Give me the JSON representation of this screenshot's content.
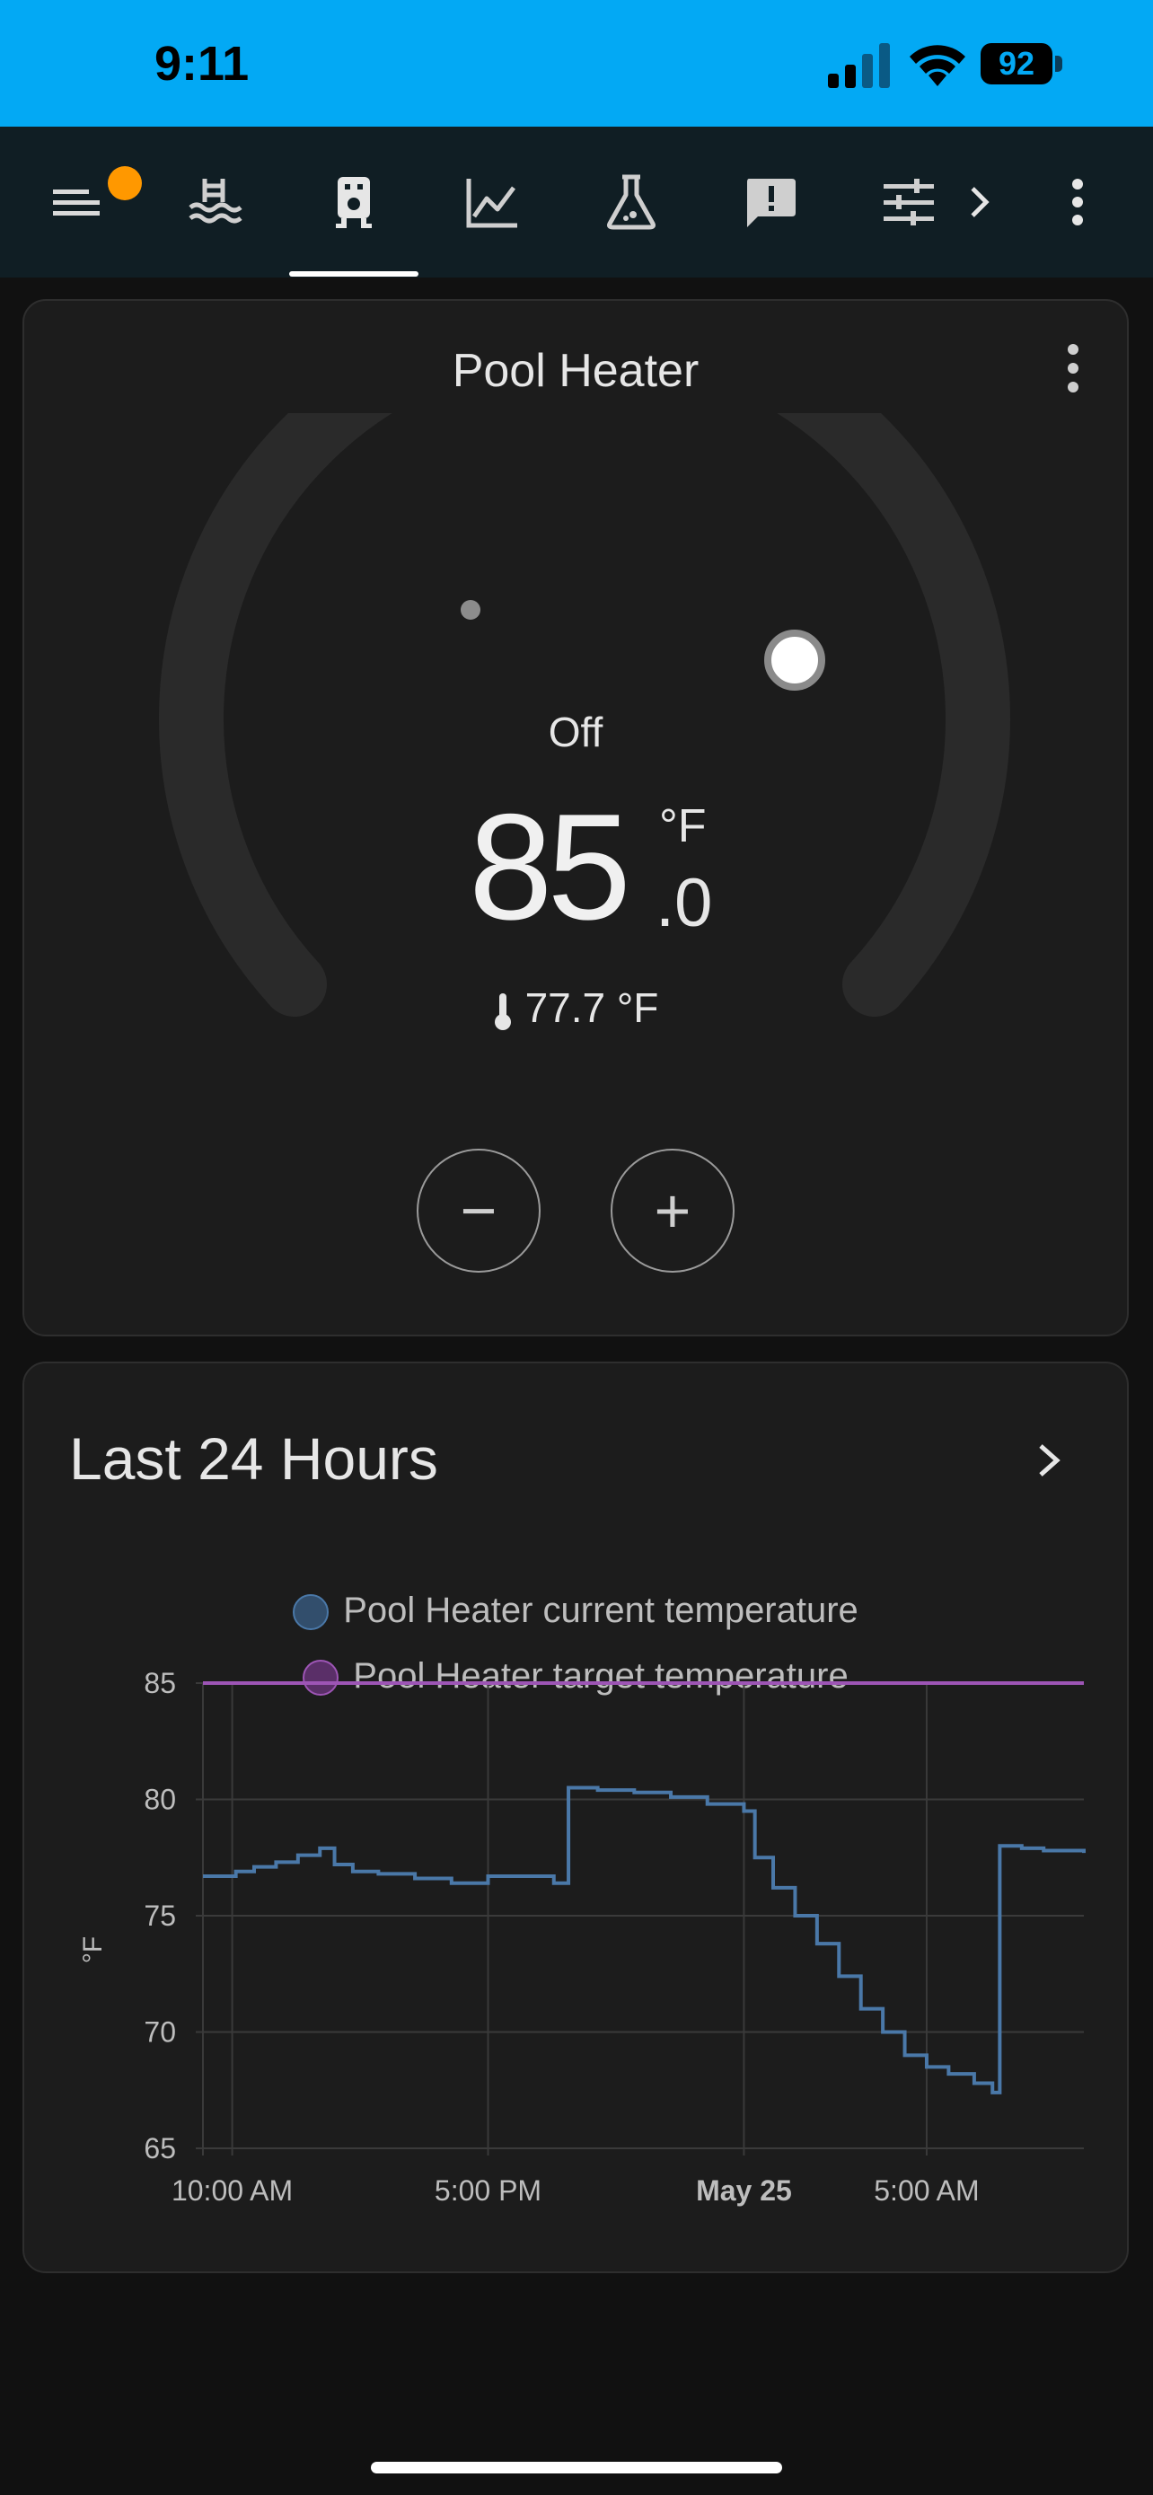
{
  "status_bar": {
    "time": "9:11",
    "battery": "92"
  },
  "toolbar": {
    "icons": [
      "menu-icon",
      "pool-icon",
      "water-heater-icon",
      "chart-line-icon",
      "flask-icon",
      "alert-icon",
      "tune-icon",
      "chevron-right-icon",
      "more-vert-icon"
    ],
    "active_tab": "water-heater-icon",
    "notification_color": "#ff9800"
  },
  "thermostat": {
    "title": "Pool Heater",
    "mode": "Off",
    "target_integer": "85",
    "target_decimal": ".0",
    "unit": "°F",
    "current_temperature": "77.7 °F",
    "minus_label": "−",
    "plus_label": "+"
  },
  "history": {
    "title": "Last 24 Hours",
    "legend": [
      {
        "label": "Pool Heater current temperature",
        "color": "#4a78a8"
      },
      {
        "label": "Pool Heater target temperature",
        "color": "#9d55b5"
      }
    ]
  },
  "chart_data": {
    "type": "line",
    "ylabel": "°F",
    "ylim": [
      65,
      85
    ],
    "yticks": [
      "85",
      "80",
      "75",
      "70",
      "65"
    ],
    "xticks": [
      {
        "label": "10:00 AM",
        "hours": 0,
        "bold": false
      },
      {
        "label": "5:00 PM",
        "hours": 7,
        "bold": false
      },
      {
        "label": "May 25",
        "hours": 14,
        "bold": true
      },
      {
        "label": "5:00 AM",
        "hours": 19,
        "bold": false
      }
    ],
    "xlim": [
      -0.8,
      23.3
    ],
    "grid": true,
    "series": [
      {
        "name": "Pool Heater current temperature",
        "color": "#4a78a8",
        "step": true,
        "points": [
          [
            -0.8,
            76.7
          ],
          [
            0.1,
            76.9
          ],
          [
            0.6,
            77.1
          ],
          [
            1.2,
            77.3
          ],
          [
            1.8,
            77.6
          ],
          [
            2.4,
            77.9
          ],
          [
            2.8,
            77.2
          ],
          [
            3.3,
            76.9
          ],
          [
            4.0,
            76.8
          ],
          [
            5.0,
            76.6
          ],
          [
            6.0,
            76.4
          ],
          [
            7.0,
            76.7
          ],
          [
            8.0,
            76.7
          ],
          [
            8.8,
            76.4
          ],
          [
            9.2,
            80.5
          ],
          [
            10.0,
            80.4
          ],
          [
            11.0,
            80.3
          ],
          [
            12.0,
            80.1
          ],
          [
            13.0,
            79.8
          ],
          [
            14.0,
            79.5
          ],
          [
            14.3,
            77.5
          ],
          [
            14.8,
            76.2
          ],
          [
            15.4,
            75.0
          ],
          [
            16.0,
            73.8
          ],
          [
            16.6,
            72.4
          ],
          [
            17.2,
            71.0
          ],
          [
            17.8,
            70.0
          ],
          [
            18.4,
            69.0
          ],
          [
            19.0,
            68.5
          ],
          [
            19.6,
            68.2
          ],
          [
            20.3,
            67.8
          ],
          [
            20.8,
            67.4
          ],
          [
            21.0,
            78.0
          ],
          [
            21.6,
            77.9
          ],
          [
            22.2,
            77.8
          ],
          [
            23.3,
            77.7
          ]
        ]
      },
      {
        "name": "Pool Heater target temperature",
        "color": "#9d55b5",
        "step": true,
        "points": [
          [
            -0.8,
            85
          ],
          [
            23.3,
            85
          ]
        ]
      }
    ]
  }
}
